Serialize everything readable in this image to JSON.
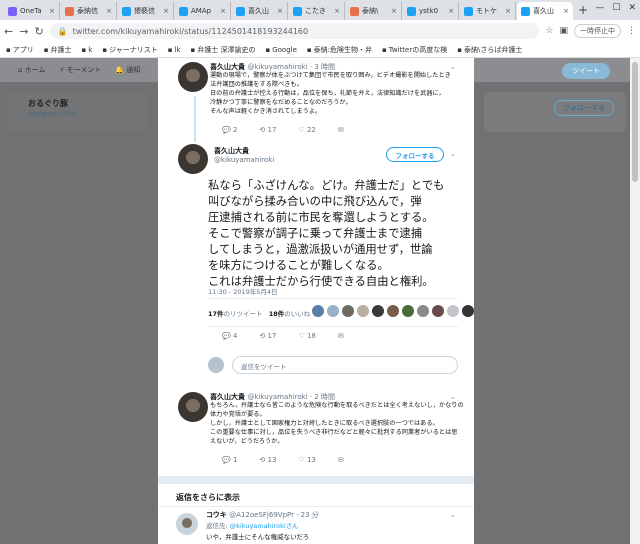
{
  "browser": {
    "tabs": [
      {
        "label": "OneTa",
        "color": "#7b61ff"
      },
      {
        "label": "泰納信",
        "color": "#e8714a"
      },
      {
        "label": "猥褻信",
        "color": "#1da1f2"
      },
      {
        "label": "AMAp",
        "color": "#1da1f2"
      },
      {
        "label": "喜久山",
        "color": "#1da1f2"
      },
      {
        "label": "こたき",
        "color": "#1da1f2"
      },
      {
        "label": "泰納\\",
        "color": "#e8714a"
      },
      {
        "label": "ystk0",
        "color": "#1da1f2"
      },
      {
        "label": "モトケ",
        "color": "#1da1f2"
      },
      {
        "label": "喜久山",
        "color": "#1da1f2",
        "active": true
      }
    ],
    "url": "twitter.com/kikuyamahiroki/status/1124501418193244160",
    "pause_label": "一時停止中",
    "bookmarks": [
      "アプリ",
      "弁護士",
      "k",
      "ジャーナリスト",
      "lk",
      "弁護士 深澤諭史の",
      "Google",
      "泰納:危険生物・弁",
      "Twitterの高度な検",
      "泰納\\さらば弁護士"
    ]
  },
  "twitter": {
    "nav": {
      "home": "ホーム",
      "moments": "モーメント",
      "notify": "通知",
      "tweet_button": "ツイート"
    },
    "profile": {
      "name": "おるぐり豚",
      "handle": "@olgreen786"
    },
    "follow_side": "フォローする",
    "prev_tweet": {
      "name": "喜久山大貴",
      "handle": "@kikuyamahiroki · 3 時間",
      "text": "運動の現場で，警察が体をぶつけて集団で市民を取り囲み，ビデオ撮影を開始したとき\n法弁護団の推護をする際べきも。\n日の前の弁護士が控える行動は，品位を保ち，礼節を弁え，法律知識だけを武器に，\n冷静かつ丁寧に警察をなだめることなのだろうか。\nそんな声は軽くかき消されてしまうよ。",
      "replies": "2",
      "retweets": "17",
      "likes": "22"
    },
    "main": {
      "name": "喜久山大貴",
      "handle": "@kikuyamahiroki",
      "follow": "フォローする",
      "text": "私なら「ふざけんな。どけ。弁護士だ」とでも\n叫びながら揉み合いの中に飛び込んで，弾\n圧逮捕される前に市民を奪還しようとする。\nそこで警察が調子に乗って弁護士まで逮捕\nしてしまうと，過激派扱いが通用せず，世論\nを味方につけることが難しくなる。\nこれは弁護士だから行使できる自由と権利。",
      "time": "11:30 - 2019年5月4日",
      "retweets_count": "17件",
      "retweets_label": "のリツイート",
      "likes_count": "18件",
      "likes_label": "のいいね",
      "replies": "4",
      "rts": "17",
      "likes": "18",
      "reply_placeholder": "返信をツイート",
      "liker_colors": [
        "#5a7fa8",
        "#9ab0c8",
        "#6b6b5f",
        "#b9b0a0",
        "#3a3a3a",
        "#7a5c4a",
        "#4a6a3a",
        "#8a8a8a",
        "#6a4a4a",
        "#c2c6cc",
        "#333"
      ]
    },
    "next_tweet": {
      "name": "喜久山大貴",
      "handle": "@kikuyamahiroki · 2 時間",
      "text": "もちろん，弁護士なら皆このような危険な行動を取るべきだとは全く考えないし，かなりの\n体力や覚悟が要る。\nしかし，弁護士として国家権力と対峙したときに取るべき選択肢の一つではある。\nこの重要な仕事に対し，品位を失うべき非行だなどと軽々に批判する同業者がいるとは思\nえないが，どうだろうか。",
      "replies": "1",
      "retweets": "13",
      "likes": "13"
    },
    "more_replies": "返信をさらに表示",
    "last_reply": {
      "name": "コウキ",
      "handle": "@A12oeSFj69VpPr · 23 分",
      "replying_prefix": "返信先: ",
      "replying_handle": "@kikuyamahirokiさん",
      "text": "いや，弁護士にそんな権威ないだろ"
    }
  }
}
